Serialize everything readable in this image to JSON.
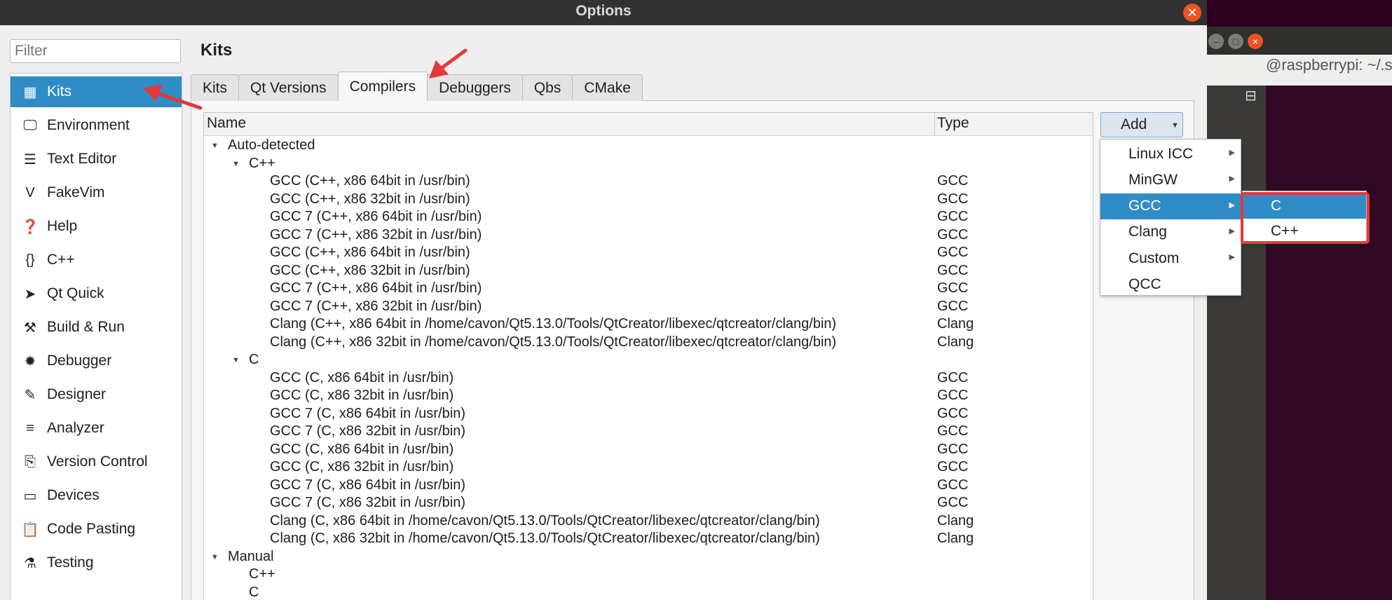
{
  "background": {
    "terminal_tab_text": "@raspberrypi: ~/.s",
    "window_buttons": [
      "–",
      "□",
      "×"
    ]
  },
  "dialog": {
    "title": "Options"
  },
  "filter": {
    "placeholder": "Filter"
  },
  "sidebar": {
    "items": [
      {
        "label": "Kits",
        "icon": "kits-icon",
        "glyph": "▦"
      },
      {
        "label": "Environment",
        "icon": "monitor-icon",
        "glyph": "🖵"
      },
      {
        "label": "Text Editor",
        "icon": "text-editor-icon",
        "glyph": "☰"
      },
      {
        "label": "FakeVim",
        "icon": "fakevim-icon",
        "glyph": "V"
      },
      {
        "label": "Help",
        "icon": "help-icon",
        "glyph": "❓"
      },
      {
        "label": "C++",
        "icon": "braces-icon",
        "glyph": "{}"
      },
      {
        "label": "Qt Quick",
        "icon": "paper-plane-icon",
        "glyph": "➤"
      },
      {
        "label": "Build & Run",
        "icon": "hammer-icon",
        "glyph": "⚒"
      },
      {
        "label": "Debugger",
        "icon": "bug-icon",
        "glyph": "✹"
      },
      {
        "label": "Designer",
        "icon": "pencil-icon",
        "glyph": "✎"
      },
      {
        "label": "Analyzer",
        "icon": "analyzer-icon",
        "glyph": "≡"
      },
      {
        "label": "Version Control",
        "icon": "version-control-icon",
        "glyph": "⎘"
      },
      {
        "label": "Devices",
        "icon": "devices-icon",
        "glyph": "▭"
      },
      {
        "label": "Code Pasting",
        "icon": "clipboard-icon",
        "glyph": "📋"
      },
      {
        "label": "Testing",
        "icon": "flask-icon",
        "glyph": "⚗"
      }
    ]
  },
  "page": {
    "title": "Kits"
  },
  "tabs": [
    "Kits",
    "Qt Versions",
    "Compilers",
    "Debuggers",
    "Qbs",
    "CMake"
  ],
  "tree": {
    "headers": {
      "name": "Name",
      "type": "Type"
    },
    "rows": [
      {
        "level": 0,
        "expanded": true,
        "name": "Auto-detected",
        "type": ""
      },
      {
        "level": 1,
        "expanded": true,
        "name": "C++",
        "type": ""
      },
      {
        "level": 2,
        "name": "GCC (C++, x86 64bit in /usr/bin)",
        "type": "GCC"
      },
      {
        "level": 2,
        "name": "GCC (C++, x86 32bit in /usr/bin)",
        "type": "GCC"
      },
      {
        "level": 2,
        "name": "GCC 7 (C++, x86 64bit in /usr/bin)",
        "type": "GCC"
      },
      {
        "level": 2,
        "name": "GCC 7 (C++, x86 32bit in /usr/bin)",
        "type": "GCC"
      },
      {
        "level": 2,
        "name": "GCC (C++, x86 64bit in /usr/bin)",
        "type": "GCC"
      },
      {
        "level": 2,
        "name": "GCC (C++, x86 32bit in /usr/bin)",
        "type": "GCC"
      },
      {
        "level": 2,
        "name": "GCC 7 (C++, x86 64bit in /usr/bin)",
        "type": "GCC"
      },
      {
        "level": 2,
        "name": "GCC 7 (C++, x86 32bit in /usr/bin)",
        "type": "GCC"
      },
      {
        "level": 2,
        "name": "Clang (C++, x86 64bit in /home/cavon/Qt5.13.0/Tools/QtCreator/libexec/qtcreator/clang/bin)",
        "type": "Clang"
      },
      {
        "level": 2,
        "name": "Clang (C++, x86 32bit in /home/cavon/Qt5.13.0/Tools/QtCreator/libexec/qtcreator/clang/bin)",
        "type": "Clang"
      },
      {
        "level": 1,
        "expanded": true,
        "name": "C",
        "type": ""
      },
      {
        "level": 2,
        "name": "GCC (C, x86 64bit in /usr/bin)",
        "type": "GCC"
      },
      {
        "level": 2,
        "name": "GCC (C, x86 32bit in /usr/bin)",
        "type": "GCC"
      },
      {
        "level": 2,
        "name": "GCC 7 (C, x86 64bit in /usr/bin)",
        "type": "GCC"
      },
      {
        "level": 2,
        "name": "GCC 7 (C, x86 32bit in /usr/bin)",
        "type": "GCC"
      },
      {
        "level": 2,
        "name": "GCC (C, x86 64bit in /usr/bin)",
        "type": "GCC"
      },
      {
        "level": 2,
        "name": "GCC (C, x86 32bit in /usr/bin)",
        "type": "GCC"
      },
      {
        "level": 2,
        "name": "GCC 7 (C, x86 64bit in /usr/bin)",
        "type": "GCC"
      },
      {
        "level": 2,
        "name": "GCC 7 (C, x86 32bit in /usr/bin)",
        "type": "GCC"
      },
      {
        "level": 2,
        "name": "Clang (C, x86 64bit in /home/cavon/Qt5.13.0/Tools/QtCreator/libexec/qtcreator/clang/bin)",
        "type": "Clang"
      },
      {
        "level": 2,
        "name": "Clang (C, x86 32bit in /home/cavon/Qt5.13.0/Tools/QtCreator/libexec/qtcreator/clang/bin)",
        "type": "Clang"
      },
      {
        "level": 0,
        "expanded": true,
        "name": "Manual",
        "type": ""
      },
      {
        "level": 1,
        "name": "C++",
        "type": ""
      },
      {
        "level": 1,
        "name": "C",
        "type": ""
      }
    ]
  },
  "add_button": {
    "label": "Add"
  },
  "add_menu": {
    "items": [
      {
        "label": "Linux ICC",
        "submenu": true
      },
      {
        "label": "MinGW",
        "submenu": true
      },
      {
        "label": "GCC",
        "submenu": true,
        "highlighted": true
      },
      {
        "label": "Clang",
        "submenu": true
      },
      {
        "label": "Custom",
        "submenu": true
      },
      {
        "label": "QCC",
        "submenu": false
      }
    ]
  },
  "gcc_submenu": {
    "items": [
      {
        "label": "C",
        "highlighted": true
      },
      {
        "label": "C++",
        "highlighted": false
      }
    ]
  },
  "colors": {
    "selection": "#308cc6",
    "annotation_red": "#e53838",
    "titlebar": "#323232",
    "close_button": "#e95420",
    "desktop": "#2c001e"
  }
}
